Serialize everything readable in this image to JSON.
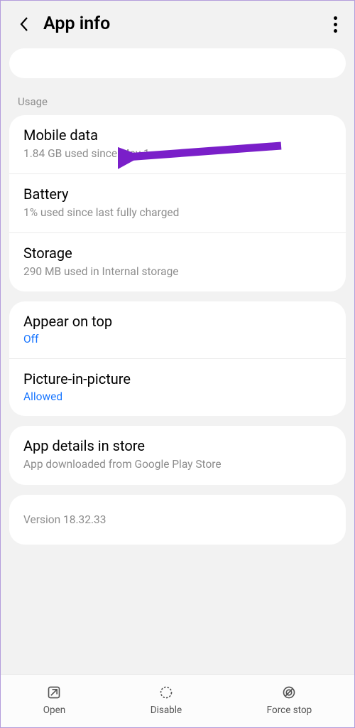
{
  "header": {
    "title": "App info"
  },
  "usage_section": {
    "label": "Usage",
    "items": [
      {
        "title": "Mobile data",
        "sub": "1.84 GB used since May 1"
      },
      {
        "title": "Battery",
        "sub": "1% used since last fully charged"
      },
      {
        "title": "Storage",
        "sub": "290 MB used in Internal storage"
      }
    ]
  },
  "overlay_section": {
    "items": [
      {
        "title": "Appear on top",
        "value": "Off"
      },
      {
        "title": "Picture-in-picture",
        "value": "Allowed"
      }
    ]
  },
  "store_section": {
    "title": "App details in store",
    "sub": "App downloaded from Google Play Store"
  },
  "version": "Version 18.32.33",
  "bottom": {
    "open": "Open",
    "disable": "Disable",
    "force_stop": "Force stop"
  },
  "colors": {
    "accent_arrow": "#7a1fc9"
  }
}
